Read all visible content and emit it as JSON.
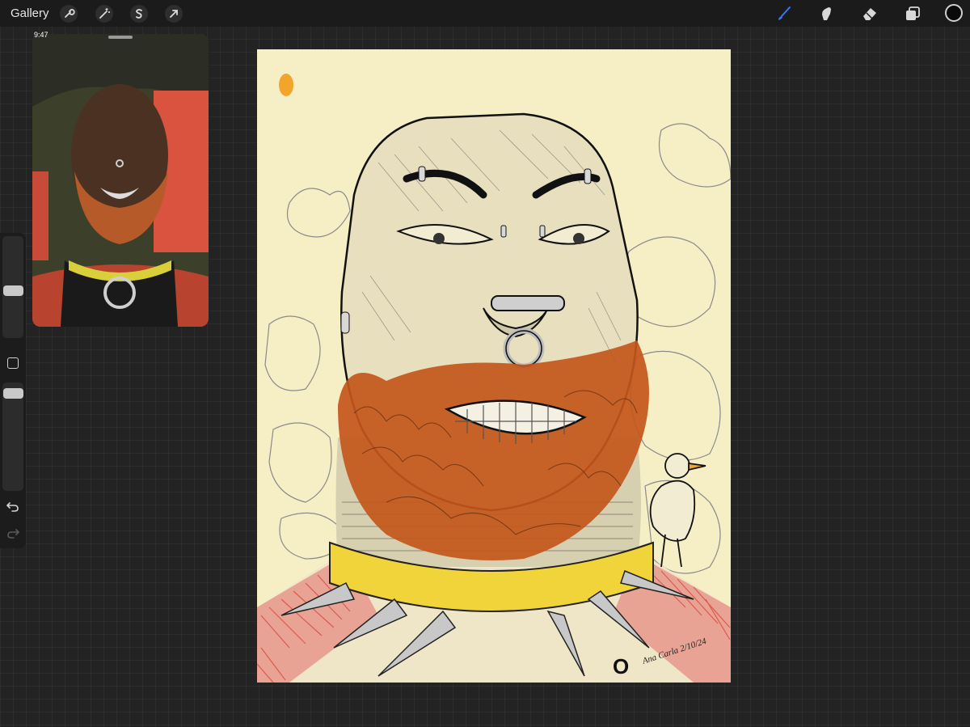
{
  "topbar": {
    "gallery_label": "Gallery",
    "left_tools": [
      {
        "name": "actions",
        "icon": "wrench-icon"
      },
      {
        "name": "adjustments",
        "icon": "magic-wand-icon"
      },
      {
        "name": "selection",
        "icon": "selection-s-icon"
      },
      {
        "name": "transform",
        "icon": "arrow-cursor-icon"
      }
    ],
    "right_tools": [
      {
        "name": "brush",
        "icon": "brush-icon",
        "active": true
      },
      {
        "name": "smudge",
        "icon": "smudge-finger-icon",
        "active": false
      },
      {
        "name": "eraser",
        "icon": "eraser-icon",
        "active": false
      },
      {
        "name": "layers",
        "icon": "layers-icon",
        "active": false
      }
    ],
    "current_color": "#0a0a0a",
    "active_tool_color": "#2f7cf6"
  },
  "reference": {
    "time": "9:47"
  },
  "sidebar": {
    "icons": [
      "undo-icon",
      "redo-icon",
      "modify-square-icon"
    ]
  },
  "artwork": {
    "signature": "Ana Carla 2/10/24",
    "collar_letter": "O",
    "palette": {
      "paper": "#f6efc6",
      "beard": "#c3561b",
      "collar": "#f1d43a",
      "shirt_red": "#d94a3c",
      "accent_orange": "#f2a52a"
    }
  }
}
